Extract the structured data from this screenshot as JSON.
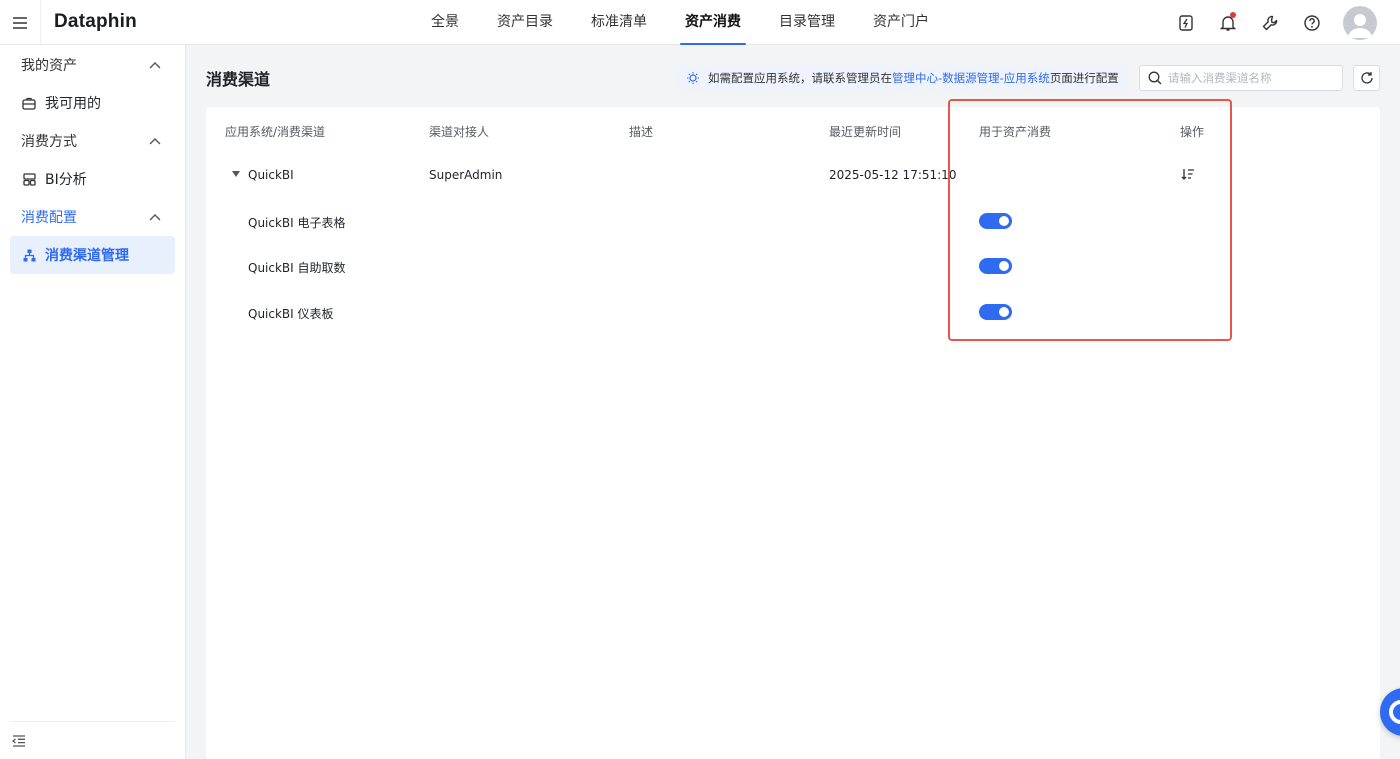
{
  "app": {
    "logo": "Dataphin"
  },
  "nav": {
    "items": [
      {
        "label": "全景",
        "active": false
      },
      {
        "label": "资产目录",
        "active": false
      },
      {
        "label": "标准清单",
        "active": false
      },
      {
        "label": "资产消费",
        "active": true
      },
      {
        "label": "目录管理",
        "active": false
      },
      {
        "label": "资产门户",
        "active": false
      }
    ]
  },
  "top_icons": [
    "flash-card-icon",
    "bell-icon",
    "wrench-icon",
    "help-icon",
    "avatar"
  ],
  "sidebar": {
    "groups": [
      {
        "label": "我的资产",
        "items": [
          {
            "label": "我可用的",
            "icon": "briefcase-icon"
          }
        ]
      },
      {
        "label": "消费方式",
        "items": [
          {
            "label": "BI分析",
            "icon": "bi-analysis-icon"
          }
        ]
      },
      {
        "label": "消费配置",
        "items": [
          {
            "label": "消费渠道管理",
            "icon": "hierarchy-icon",
            "active": true
          }
        ]
      }
    ]
  },
  "main": {
    "title": "消费渠道",
    "tip": {
      "prefix": "如需配置应用系统，请联系管理员在",
      "link": "管理中心-数据源管理-应用系统",
      "suffix": "页面进行配置"
    },
    "search": {
      "placeholder": "请输入消费渠道名称",
      "value": ""
    }
  },
  "table": {
    "columns": [
      "应用系统/消费渠道",
      "渠道对接人",
      "描述",
      "最近更新时间",
      "用于资产消费",
      "操作"
    ],
    "parent_row": {
      "name": "QuickBI",
      "contact": "SuperAdmin",
      "description": "",
      "updated": "2025-05-12 17:51:10",
      "expanded": true
    },
    "child_rows": [
      {
        "name": "QuickBI 电子表格",
        "enabled": true
      },
      {
        "name": "QuickBI 自助取数",
        "enabled": true
      },
      {
        "name": "QuickBI 仪表板",
        "enabled": true
      }
    ]
  },
  "colors": {
    "accent": "#2f6bf0",
    "highlight": "#e4574a",
    "badge": "#e53935"
  }
}
